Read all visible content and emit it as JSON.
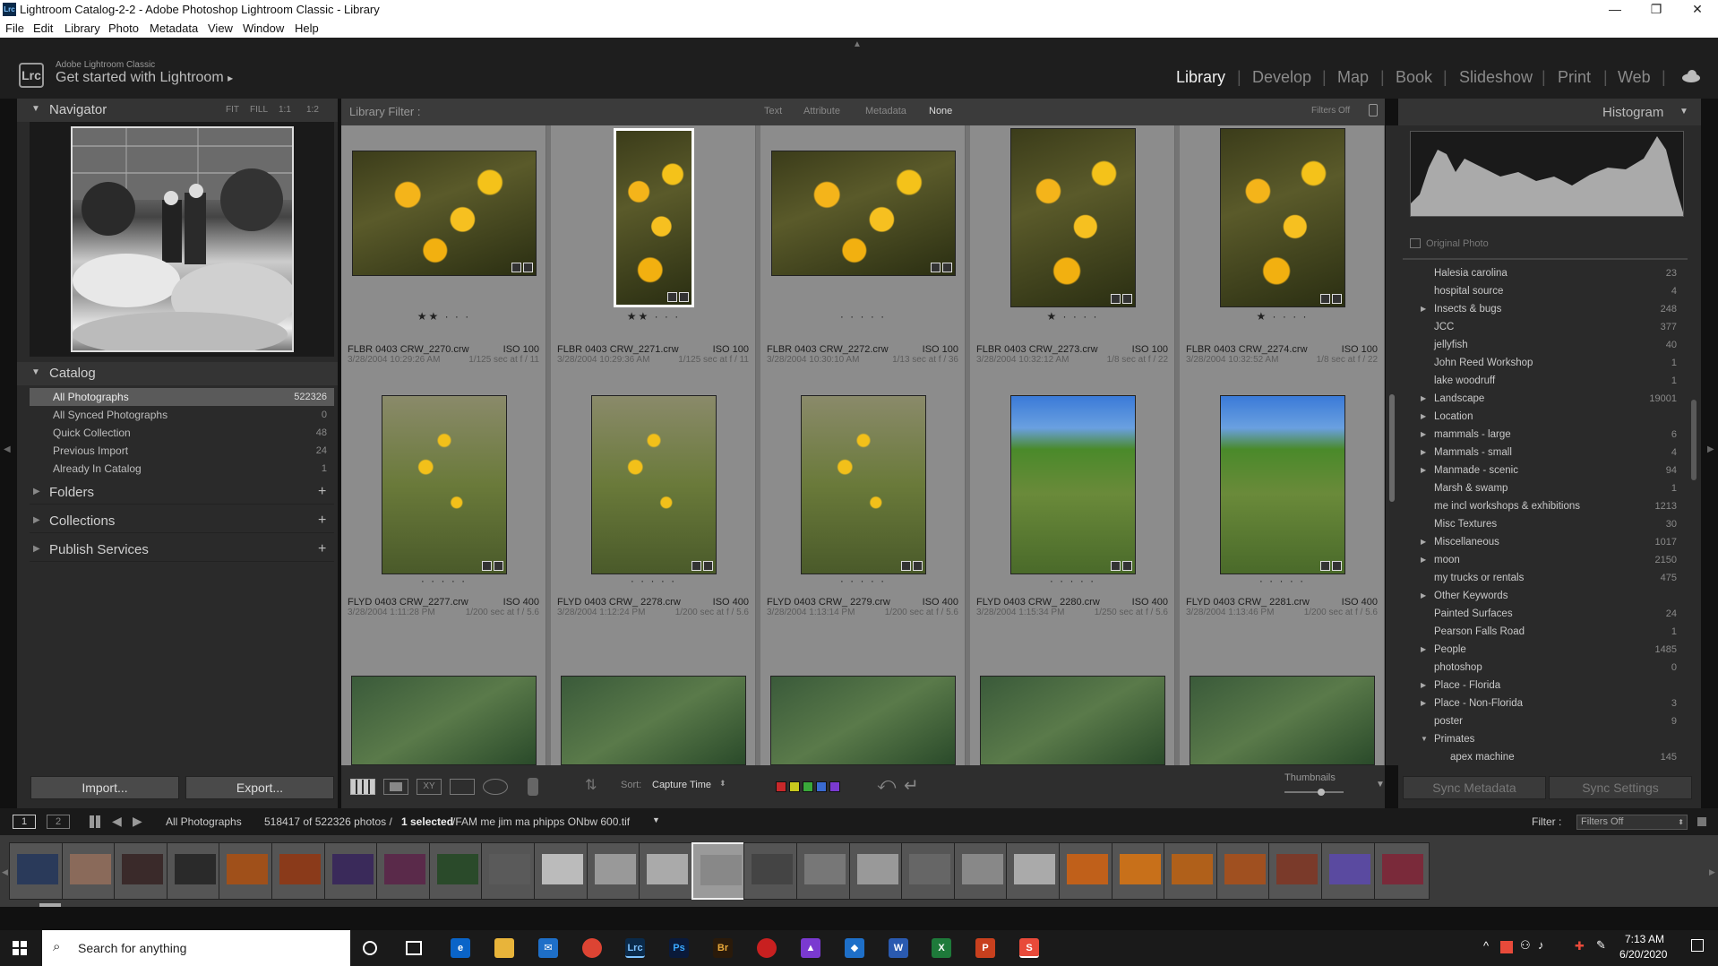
{
  "window": {
    "title": "Lightroom Catalog-2-2 - Adobe Photoshop Lightroom Classic - Library",
    "icon": "Lrc"
  },
  "menu": [
    "File",
    "Edit",
    "Library",
    "Photo",
    "Metadata",
    "View",
    "Window",
    "Help"
  ],
  "identity": {
    "small": "Adobe Lightroom Classic",
    "big": "Get started with Lightroom",
    "arrow": "▸",
    "logo": "Lrc"
  },
  "modules": [
    "Library",
    "Develop",
    "Map",
    "Book",
    "Slideshow",
    "Print",
    "Web"
  ],
  "navigator": {
    "title": "Navigator",
    "zoom": [
      "FIT",
      "FILL",
      "1:1",
      "1:2"
    ]
  },
  "catalog": {
    "title": "Catalog",
    "items": [
      {
        "label": "All Photographs",
        "count": "522326"
      },
      {
        "label": "All Synced Photographs",
        "count": "0"
      },
      {
        "label": "Quick Collection",
        "count": "48"
      },
      {
        "label": "Previous Import",
        "count": "24"
      },
      {
        "label": "Already In Catalog",
        "count": "1"
      }
    ]
  },
  "left_sections": [
    "Folders",
    "Collections",
    "Publish Services"
  ],
  "left_buttons": {
    "import": "Import...",
    "export": "Export..."
  },
  "filter": {
    "label": "Library Filter :",
    "options": [
      "Text",
      "Attribute",
      "Metadata",
      "None"
    ],
    "status": "Filters Off"
  },
  "grid": [
    {
      "name": "FLBR 0403 CRW_2270.crw",
      "iso": "ISO 100",
      "date": "3/28/2004 10:29:26 AM",
      "exp": "1/125 sec at f / 11",
      "stars": "★★ · · ·",
      "orient": "land",
      "tone": "flower"
    },
    {
      "name": "FLBR 0403 CRW_2271.crw",
      "iso": "ISO 100",
      "date": "3/28/2004 10:29:36 AM",
      "exp": "1/125 sec at f / 11",
      "stars": "★★ · · ·",
      "orient": "tall",
      "tone": "flower"
    },
    {
      "name": "FLBR 0403 CRW_2272.crw",
      "iso": "ISO 100",
      "date": "3/28/2004 10:30:10 AM",
      "exp": "1/13 sec at f / 36",
      "stars": "· · · · ·",
      "orient": "land",
      "tone": "flower"
    },
    {
      "name": "FLBR 0403 CRW_2273.crw",
      "iso": "ISO 100",
      "date": "3/28/2004 10:32:12 AM",
      "exp": "1/8 sec at f / 22",
      "stars": "★ · · · ·",
      "orient": "port",
      "tone": "flower"
    },
    {
      "name": "FLBR 0403 CRW_2274.crw",
      "iso": "ISO 100",
      "date": "3/28/2004 10:32:52 AM",
      "exp": "1/8 sec at f / 22",
      "stars": "★ · · · ·",
      "orient": "port",
      "tone": "flower"
    },
    {
      "name": "FLYD 0403 CRW_2277.crw",
      "iso": "ISO 400",
      "date": "3/28/2004 1:11:28 PM",
      "exp": "1/200 sec at f / 5.6",
      "stars": "· · · · ·",
      "orient": "port",
      "tone": "meadow"
    },
    {
      "name": "FLYD 0403 CRW_ 2278.crw",
      "iso": "ISO 400",
      "date": "3/28/2004 1:12:24 PM",
      "exp": "1/200 sec at f / 5.6",
      "stars": "· · · · ·",
      "orient": "port",
      "tone": "meadow"
    },
    {
      "name": "FLYD 0403 CRW_ 2279.crw",
      "iso": "ISO 400",
      "date": "3/28/2004 1:13:14 PM",
      "exp": "1/200 sec at f / 5.6",
      "stars": "· · · · ·",
      "orient": "port",
      "tone": "meadow"
    },
    {
      "name": "FLYD 0403 CRW_ 2280.crw",
      "iso": "ISO 400",
      "date": "3/28/2004 1:15:34 PM",
      "exp": "1/250 sec at f / 5.6",
      "stars": "· · · · ·",
      "orient": "port",
      "tone": "sky"
    },
    {
      "name": "FLYD 0403 CRW_ 2281.crw",
      "iso": "ISO 400",
      "date": "3/28/2004 1:13:46 PM",
      "exp": "1/200 sec at f / 5.6",
      "stars": "· · · · ·",
      "orient": "port",
      "tone": "sky"
    }
  ],
  "histogram": {
    "title": "Histogram",
    "original": "Original Photo"
  },
  "keywords": [
    {
      "label": "Halesia carolina",
      "count": "23",
      "tri": ""
    },
    {
      "label": "hospital source",
      "count": "4",
      "tri": ""
    },
    {
      "label": "Insects & bugs",
      "count": "248",
      "tri": "▶"
    },
    {
      "label": "JCC",
      "count": "377",
      "tri": ""
    },
    {
      "label": "jellyfish",
      "count": "40",
      "tri": ""
    },
    {
      "label": "John Reed Workshop",
      "count": "1",
      "tri": ""
    },
    {
      "label": "lake woodruff",
      "count": "1",
      "tri": ""
    },
    {
      "label": "Landscape",
      "count": "19001",
      "tri": "▶"
    },
    {
      "label": "Location",
      "count": "",
      "tri": "▶"
    },
    {
      "label": "mammals - large",
      "count": "6",
      "tri": "▶"
    },
    {
      "label": "Mammals - small",
      "count": "4",
      "tri": "▶"
    },
    {
      "label": "Manmade - scenic",
      "count": "94",
      "tri": "▶"
    },
    {
      "label": "Marsh & swamp",
      "count": "1",
      "tri": ""
    },
    {
      "label": "me incl workshops & exhibitions",
      "count": "1213",
      "tri": ""
    },
    {
      "label": "Misc Textures",
      "count": "30",
      "tri": ""
    },
    {
      "label": "Miscellaneous",
      "count": "1017",
      "tri": "▶"
    },
    {
      "label": "moon",
      "count": "2150",
      "tri": "▶"
    },
    {
      "label": "my trucks or rentals",
      "count": "475",
      "tri": ""
    },
    {
      "label": "Other Keywords",
      "count": "",
      "tri": "▶"
    },
    {
      "label": "Painted Surfaces",
      "count": "24",
      "tri": ""
    },
    {
      "label": "Pearson Falls Road",
      "count": "1",
      "tri": ""
    },
    {
      "label": "People",
      "count": "1485",
      "tri": "▶"
    },
    {
      "label": "photoshop",
      "count": "0",
      "tri": ""
    },
    {
      "label": "Place - Florida",
      "count": "",
      "tri": "▶"
    },
    {
      "label": "Place - Non-Florida",
      "count": "3",
      "tri": "▶"
    },
    {
      "label": "poster",
      "count": "9",
      "tri": ""
    },
    {
      "label": "Primates",
      "count": "",
      "tri": "▼"
    },
    {
      "label": "apex machine",
      "count": "145",
      "tri": "sub"
    }
  ],
  "right_buttons": {
    "sync_meta": "Sync Metadata",
    "sync_set": "Sync Settings"
  },
  "toolbar": {
    "sort_label": "Sort:",
    "sort_value": "Capture Time",
    "thumbs": "Thumbnails",
    "colors": [
      "#c8282a",
      "#c8c81e",
      "#3aa83a",
      "#3a6ad0",
      "#7a3ad0"
    ]
  },
  "filmstrip": {
    "page1": "1",
    "page2": "2",
    "source": "All Photographs",
    "count": "518417 of 522326 photos /",
    "selected": "1 selected",
    "file": "/FAM me jim ma phipps ONbw 600.tif",
    "filter_label": "Filter :",
    "filter_value": "Filters Off"
  },
  "taskbar": {
    "search": "Search for anything",
    "time": "7:13 AM",
    "date": "6/20/2020"
  }
}
